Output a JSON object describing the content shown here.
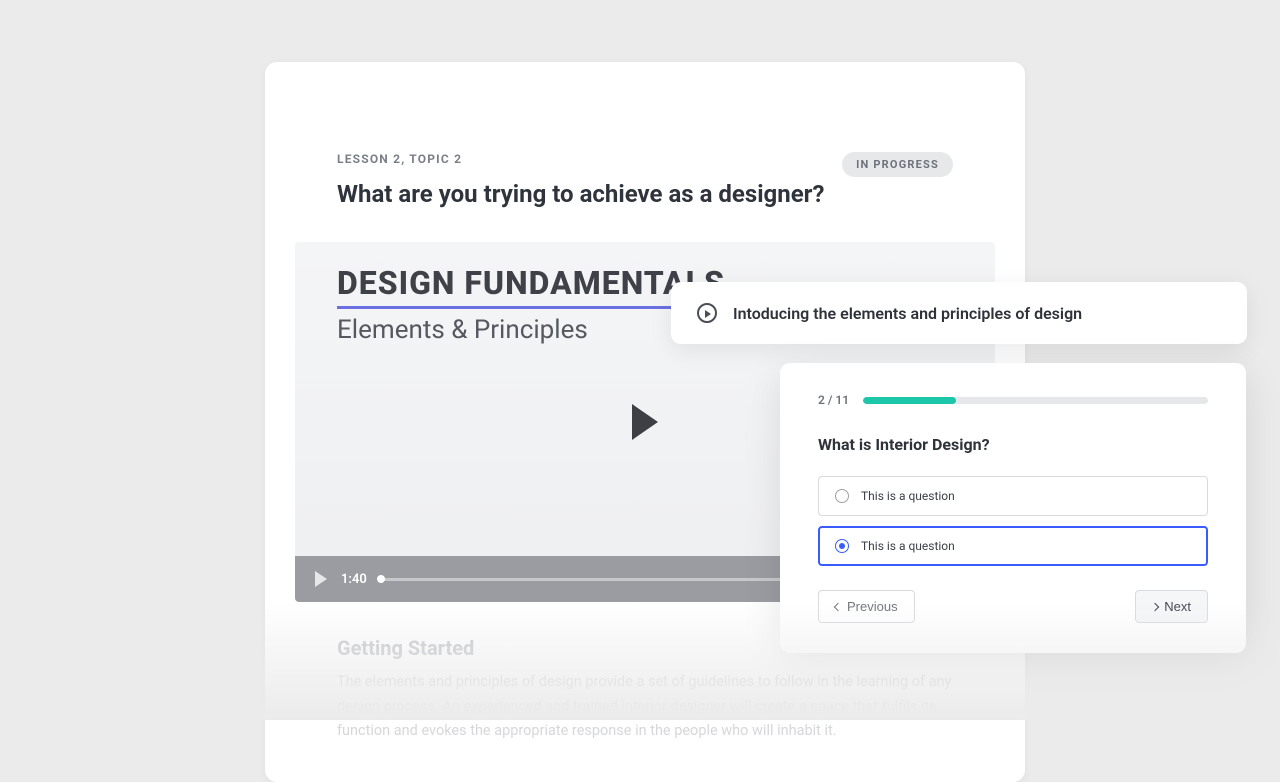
{
  "lesson": {
    "breadcrumb": "LESSON 2, TOPIC 2",
    "title": "What are you trying to achieve as a designer?",
    "status": "IN PROGRESS"
  },
  "video": {
    "overlay_title": "DESIGN FUNDAMENTALS",
    "overlay_subtitle": "Elements & Principles",
    "timestamp": "1:40"
  },
  "article": {
    "heading": "Getting Started",
    "body": "The elements and principles of design provide a set of guidelines to follow in the learning of any design process. An experienced and trained interior designer will create a space that fulfils its function and evokes the appropriate response in the people who will inhabit it."
  },
  "chip": {
    "label": "Intoducing the elements and principles of design"
  },
  "quiz": {
    "counter": "2 / 11",
    "progress_percent": 27,
    "question": "What is Interior Design?",
    "options": [
      {
        "label": "This is a question",
        "selected": false
      },
      {
        "label": "This is a question",
        "selected": true
      }
    ],
    "prev_label": "Previous",
    "next_label": "Next"
  },
  "colors": {
    "accent_blue": "#3a5cff",
    "accent_teal": "#1cc6a9",
    "underline_purple": "#6b6fe0"
  }
}
